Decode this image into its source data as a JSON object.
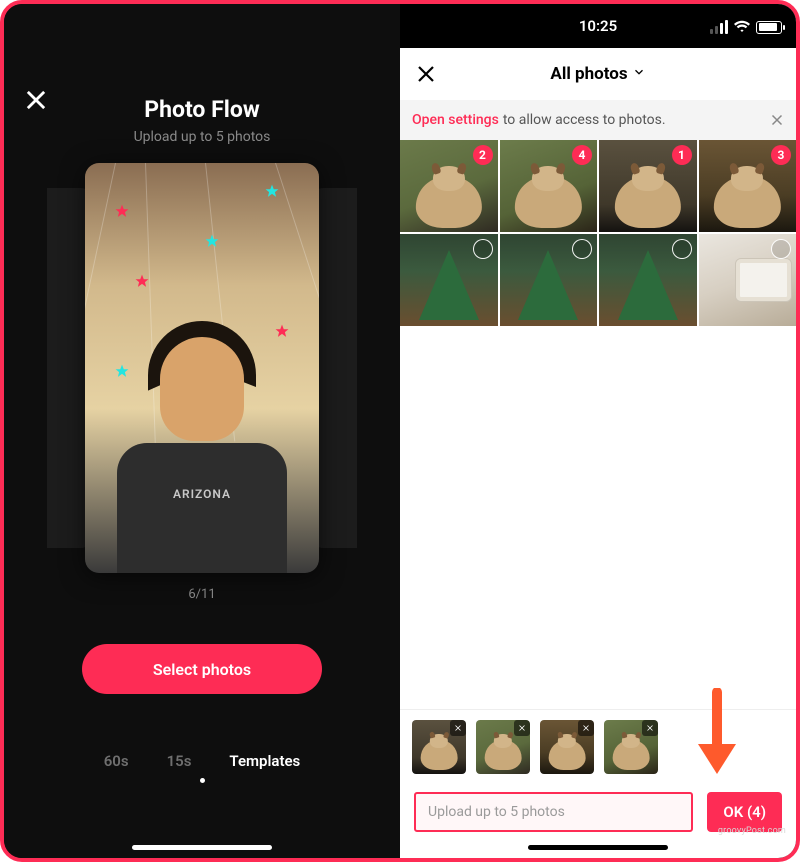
{
  "colors": {
    "accent": "#fe2c55",
    "muted": "#8a8a8a"
  },
  "left": {
    "title": "Photo Flow",
    "subtitle": "Upload up to 5 photos",
    "shirt_text": "ARIZONA",
    "counter": "6/11",
    "select_button": "Select photos",
    "tabs": {
      "sixty": "60s",
      "fifteen": "15s",
      "templates": "Templates",
      "active_index": 2
    }
  },
  "right": {
    "statusbar": {
      "time": "10:25"
    },
    "header": {
      "title": "All photos"
    },
    "notice": {
      "link_text": "Open settings",
      "text": "to allow access to photos."
    },
    "grid": [
      {
        "badge": 2,
        "kind": "dog",
        "cls": "dog1"
      },
      {
        "badge": 4,
        "kind": "dog",
        "cls": "dog2"
      },
      {
        "badge": 1,
        "kind": "dog",
        "cls": "dog3"
      },
      {
        "badge": 3,
        "kind": "dog",
        "cls": "dog4"
      },
      {
        "badge": null,
        "kind": "tree",
        "cls": "tree"
      },
      {
        "badge": null,
        "kind": "tree",
        "cls": "tree"
      },
      {
        "badge": null,
        "kind": "tree",
        "cls": "tree"
      },
      {
        "badge": null,
        "kind": "desk",
        "cls": "desk"
      }
    ],
    "selected": [
      {
        "cls": "dog3"
      },
      {
        "cls": "dog1"
      },
      {
        "cls": "dog4"
      },
      {
        "cls": "dog2"
      }
    ],
    "limit_text": "Upload up to 5 photos",
    "ok_button": "OK (4)",
    "watermark": "groovyPost.com"
  }
}
